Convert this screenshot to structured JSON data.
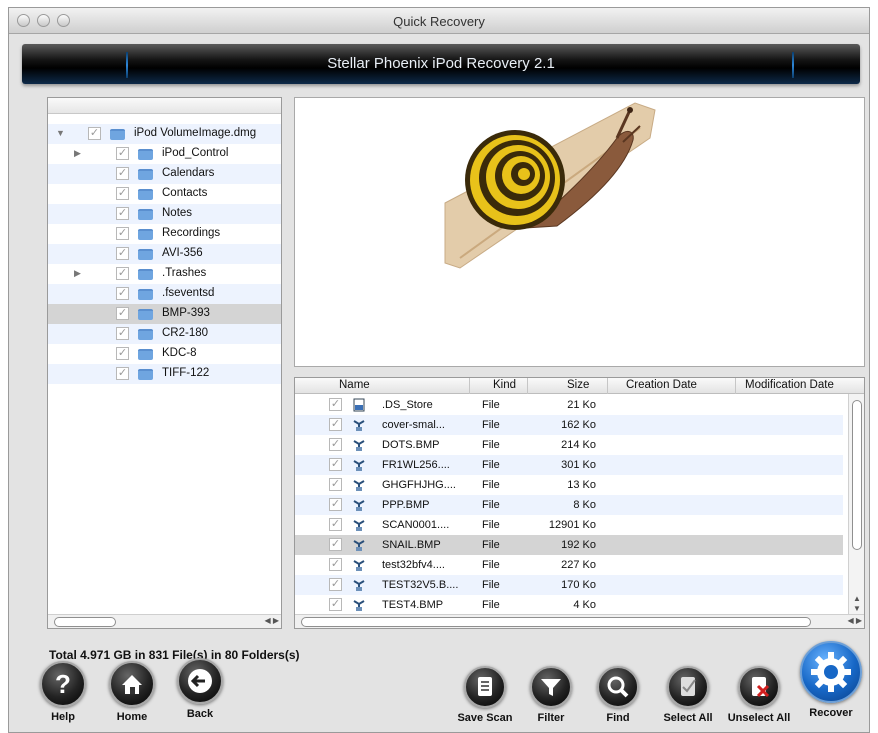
{
  "window": {
    "title": "Quick Recovery"
  },
  "banner": {
    "title": "Stellar Phoenix iPod Recovery 2.1"
  },
  "tree": {
    "items": [
      {
        "label": "iPod VolumeImage.dmg",
        "level": 0,
        "expandable": true,
        "expanded": true,
        "checked": true,
        "selected": false
      },
      {
        "label": "iPod_Control",
        "level": 1,
        "expandable": true,
        "expanded": false,
        "checked": true,
        "selected": false
      },
      {
        "label": "Calendars",
        "level": 1,
        "expandable": false,
        "checked": true,
        "selected": false
      },
      {
        "label": "Contacts",
        "level": 1,
        "expandable": false,
        "checked": true,
        "selected": false
      },
      {
        "label": "Notes",
        "level": 1,
        "expandable": false,
        "checked": true,
        "selected": false
      },
      {
        "label": "Recordings",
        "level": 1,
        "expandable": false,
        "checked": true,
        "selected": false
      },
      {
        "label": "AVI-356",
        "level": 1,
        "expandable": false,
        "checked": true,
        "selected": false
      },
      {
        "label": ".Trashes",
        "level": 1,
        "expandable": true,
        "expanded": false,
        "checked": true,
        "selected": false
      },
      {
        "label": ".fseventsd",
        "level": 1,
        "expandable": false,
        "checked": true,
        "selected": false
      },
      {
        "label": "BMP-393",
        "level": 1,
        "expandable": false,
        "checked": true,
        "selected": true
      },
      {
        "label": "CR2-180",
        "level": 1,
        "expandable": false,
        "checked": true,
        "selected": false
      },
      {
        "label": "KDC-8",
        "level": 1,
        "expandable": false,
        "checked": true,
        "selected": false
      },
      {
        "label": "TIFF-122",
        "level": 1,
        "expandable": false,
        "checked": true,
        "selected": false
      }
    ]
  },
  "files": {
    "columns": {
      "name": "Name",
      "kind": "Kind",
      "size": "Size",
      "created": "Creation Date",
      "modified": "Modification Date"
    },
    "rows": [
      {
        "name": ".DS_Store",
        "kind": "File",
        "size": "21 Ko",
        "icon": "doc-icon",
        "selected": false
      },
      {
        "name": "cover-smal...",
        "kind": "File",
        "size": "162 Ko",
        "icon": "image-icon",
        "selected": false
      },
      {
        "name": "DOTS.BMP",
        "kind": "File",
        "size": "214 Ko",
        "icon": "image-icon",
        "selected": false
      },
      {
        "name": "FR1WL256....",
        "kind": "File",
        "size": "301 Ko",
        "icon": "image-icon",
        "selected": false
      },
      {
        "name": "GHGFHJHG....",
        "kind": "File",
        "size": "13 Ko",
        "icon": "image-icon",
        "selected": false
      },
      {
        "name": "PPP.BMP",
        "kind": "File",
        "size": "8 Ko",
        "icon": "image-icon",
        "selected": false
      },
      {
        "name": "SCAN0001....",
        "kind": "File",
        "size": "12901 Ko",
        "icon": "image-icon",
        "selected": false
      },
      {
        "name": "SNAIL.BMP",
        "kind": "File",
        "size": "192 Ko",
        "icon": "image-icon",
        "selected": true
      },
      {
        "name": "test32bfv4....",
        "kind": "File",
        "size": "227 Ko",
        "icon": "image-icon",
        "selected": false
      },
      {
        "name": "TEST32V5.B....",
        "kind": "File",
        "size": "170 Ko",
        "icon": "image-icon",
        "selected": false
      },
      {
        "name": "TEST4.BMP",
        "kind": "File",
        "size": "4 Ko",
        "icon": "image-icon",
        "selected": false
      }
    ]
  },
  "status": {
    "total": "Total  4.971 GB in 831 File(s) in 80 Folders(s)"
  },
  "toolbar": {
    "help": "Help",
    "home": "Home",
    "back": "Back",
    "save_scan": "Save Scan",
    "filter": "Filter",
    "find": "Find",
    "select_all": "Select All",
    "unselect_all": "Unselect All",
    "recover": "Recover"
  },
  "colors": {
    "accent": "#1767c6",
    "row_alt": "#edf3fe",
    "row_selected": "#d4d4d4"
  }
}
